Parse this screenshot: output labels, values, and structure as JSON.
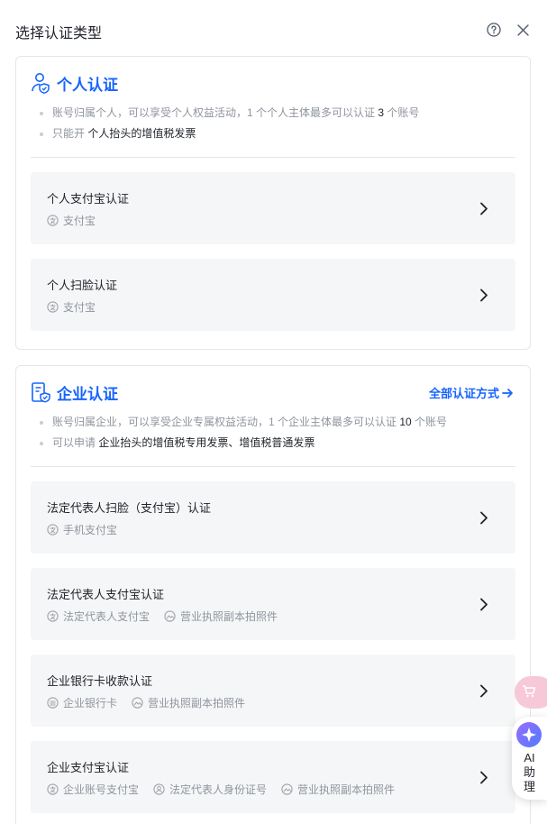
{
  "header": {
    "title": "选择认证类型"
  },
  "personal": {
    "title": "个人认证",
    "bullets": [
      {
        "pre": "账号归属个人，可以享受个人权益活动，1 个个人主体最多可以认证 ",
        "strong": "3",
        "post": " 个账号"
      },
      {
        "pre": "只能开 ",
        "strong": "个人抬头的增值税发票",
        "post": ""
      }
    ],
    "options": [
      {
        "title": "个人支付宝认证",
        "tags": [
          {
            "icon": "alipay-icon",
            "label": "支付宝"
          }
        ]
      },
      {
        "title": "个人扫脸认证",
        "tags": [
          {
            "icon": "alipay-icon",
            "label": "支付宝"
          }
        ]
      }
    ]
  },
  "company": {
    "title": "企业认证",
    "all_methods": "全部认证方式",
    "bullets": [
      {
        "pre": "账号归属企业，可以享受企业专属权益活动，1 个企业主体最多可以认证 ",
        "strong": "10",
        "post": " 个账号"
      },
      {
        "pre": "可以申请 ",
        "strong": "企业抬头的增值税专用发票、增值税普通发票",
        "post": ""
      }
    ],
    "options": [
      {
        "title": "法定代表人扫脸（支付宝）认证",
        "tags": [
          {
            "icon": "alipay-icon",
            "label": "手机支付宝"
          }
        ]
      },
      {
        "title": "法定代表人支付宝认证",
        "tags": [
          {
            "icon": "alipay-icon",
            "label": "法定代表人支付宝"
          },
          {
            "icon": "license-photo-icon",
            "label": "营业执照副本拍照件"
          }
        ]
      },
      {
        "title": "企业银行卡收款认证",
        "tags": [
          {
            "icon": "bank-card-icon",
            "label": "企业银行卡"
          },
          {
            "icon": "license-photo-icon",
            "label": "营业执照副本拍照件"
          }
        ]
      },
      {
        "title": "企业支付宝认证",
        "tags": [
          {
            "icon": "alipay-icon",
            "label": "企业账号支付宝"
          },
          {
            "icon": "id-person-icon",
            "label": "法定代表人身份证号"
          },
          {
            "icon": "license-photo-icon",
            "label": "营业执照副本拍照件"
          }
        ]
      }
    ]
  },
  "float": {
    "ai_label": "AI\n助\n理"
  },
  "colors": {
    "accent": "#1664ff",
    "option_bg": "#f5f6f7",
    "muted": "#8f959e"
  }
}
